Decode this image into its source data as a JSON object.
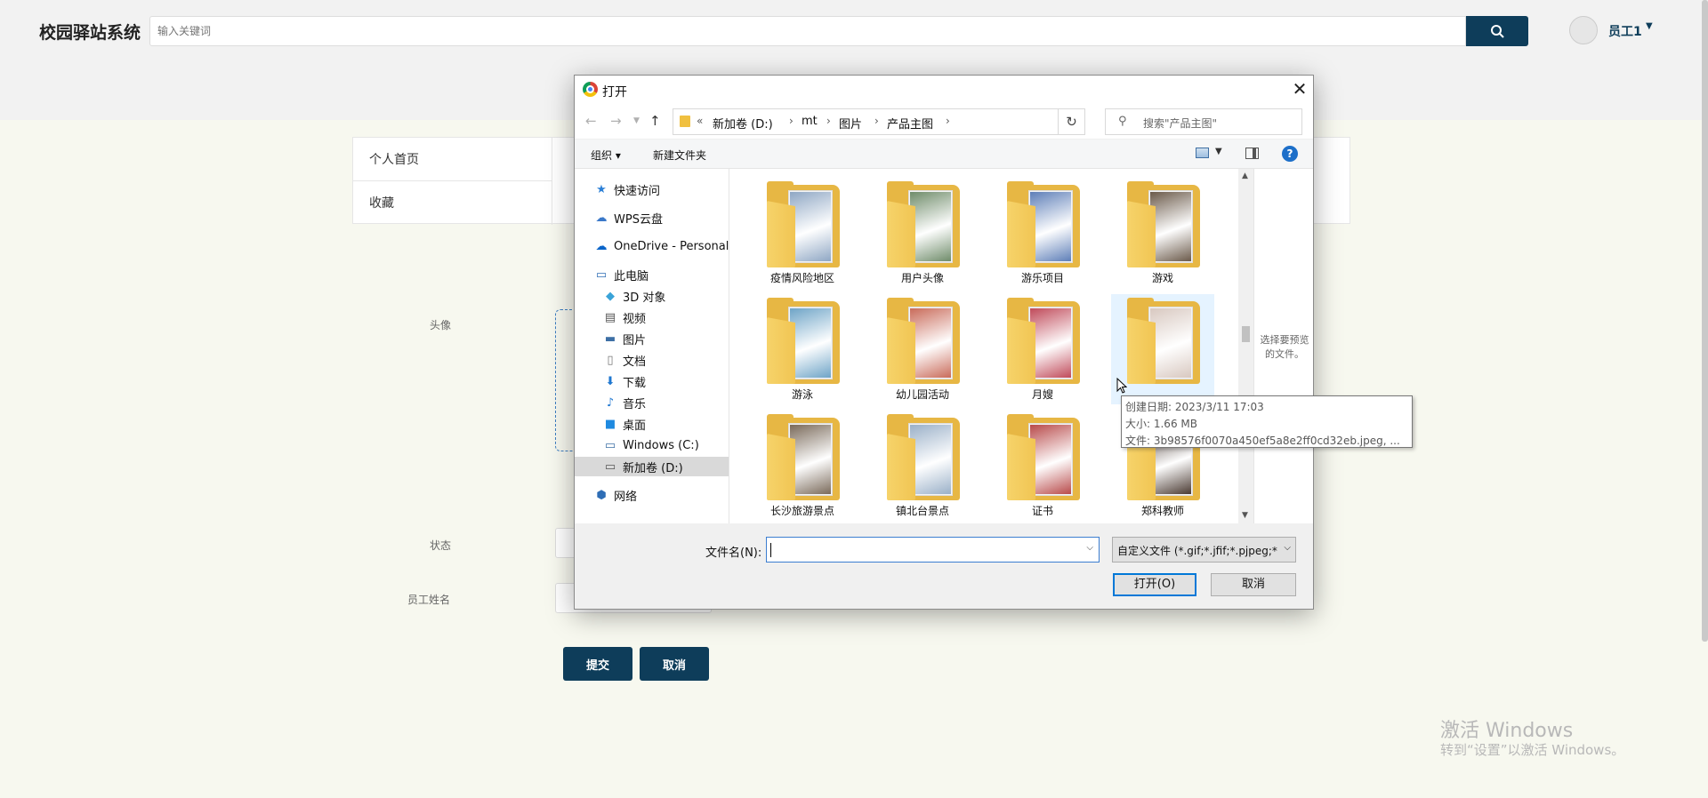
{
  "page": {
    "logo": "校园驿站系统",
    "search_placeholder": "输入关键词",
    "user_name": "员工1",
    "menu": [
      [
        "个人首页",
        "收藏"
      ]
    ],
    "menu_cells": [
      "个人首页",
      "收藏"
    ],
    "labels": {
      "avatar": "头像",
      "status": "状态",
      "staff_name": "员工姓名"
    },
    "submit": "提交",
    "cancel": "取消",
    "watermark_title": "激活 Windows",
    "watermark_sub": "转到“设置”以激活 Windows。",
    "accent": "#0e3d5a"
  },
  "dialog": {
    "title": "打开",
    "breadcrumb": [
      "«",
      "新加卷 (D:)",
      "mt",
      "图片",
      "产品主图"
    ],
    "search_placeholder": "搜索\"产品主图\"",
    "toolbar": {
      "organize": "组织",
      "new_folder": "新建文件夹"
    },
    "nav": [
      {
        "label": "快速访问",
        "icon": "star-icon"
      },
      {
        "label": "WPS云盘",
        "icon": "cloud-icon"
      },
      {
        "label": "OneDrive - Personal",
        "icon": "onedrive-icon"
      },
      {
        "label": "此电脑",
        "icon": "computer-icon"
      },
      {
        "label": "3D 对象",
        "icon": "cube-icon"
      },
      {
        "label": "视频",
        "icon": "video-icon"
      },
      {
        "label": "图片",
        "icon": "picture-icon"
      },
      {
        "label": "文档",
        "icon": "document-icon"
      },
      {
        "label": "下载",
        "icon": "download-icon"
      },
      {
        "label": "音乐",
        "icon": "music-icon"
      },
      {
        "label": "桌面",
        "icon": "desktop-icon"
      },
      {
        "label": "Windows (C:)",
        "icon": "drive-icon"
      },
      {
        "label": "新加卷 (D:)",
        "icon": "drive-icon"
      },
      {
        "label": "网络",
        "icon": "network-icon"
      }
    ],
    "folders": [
      {
        "name": "疫情风险地区",
        "tint": "#8fa7c4"
      },
      {
        "name": "用户头像",
        "tint": "#6f8c6a"
      },
      {
        "name": "游乐项目",
        "tint": "#5e7fb8"
      },
      {
        "name": "游戏",
        "tint": "#6b5a4a"
      },
      {
        "name": "游泳",
        "tint": "#6ea4c7"
      },
      {
        "name": "幼儿园活动",
        "tint": "#c96b5a"
      },
      {
        "name": "月嫂",
        "tint": "#c04a5a"
      },
      {
        "name": "",
        "tint": "#d8c8c0"
      },
      {
        "name": "长沙旅游景点",
        "tint": "#7a6a5a"
      },
      {
        "name": "镇北台景点",
        "tint": "#9ab0c8"
      },
      {
        "name": "证书",
        "tint": "#b84a4a"
      },
      {
        "name": "郑科教师",
        "tint": "#4a3a32"
      }
    ],
    "preview_text": "选择要预览的文件。",
    "tooltip": [
      "创建日期: 2023/3/11 17:03",
      "大小: 1.66 MB",
      "文件: 3b98576f0070a450ef5a8e2ff0cd32eb.jpeg, ..."
    ],
    "filename_label": "文件名(N):",
    "filename_value": "",
    "filter": "自定义文件 (*.gif;*.jfif;*.pjpeg;*",
    "open_button": "打开(O)",
    "cancel_button": "取消"
  }
}
